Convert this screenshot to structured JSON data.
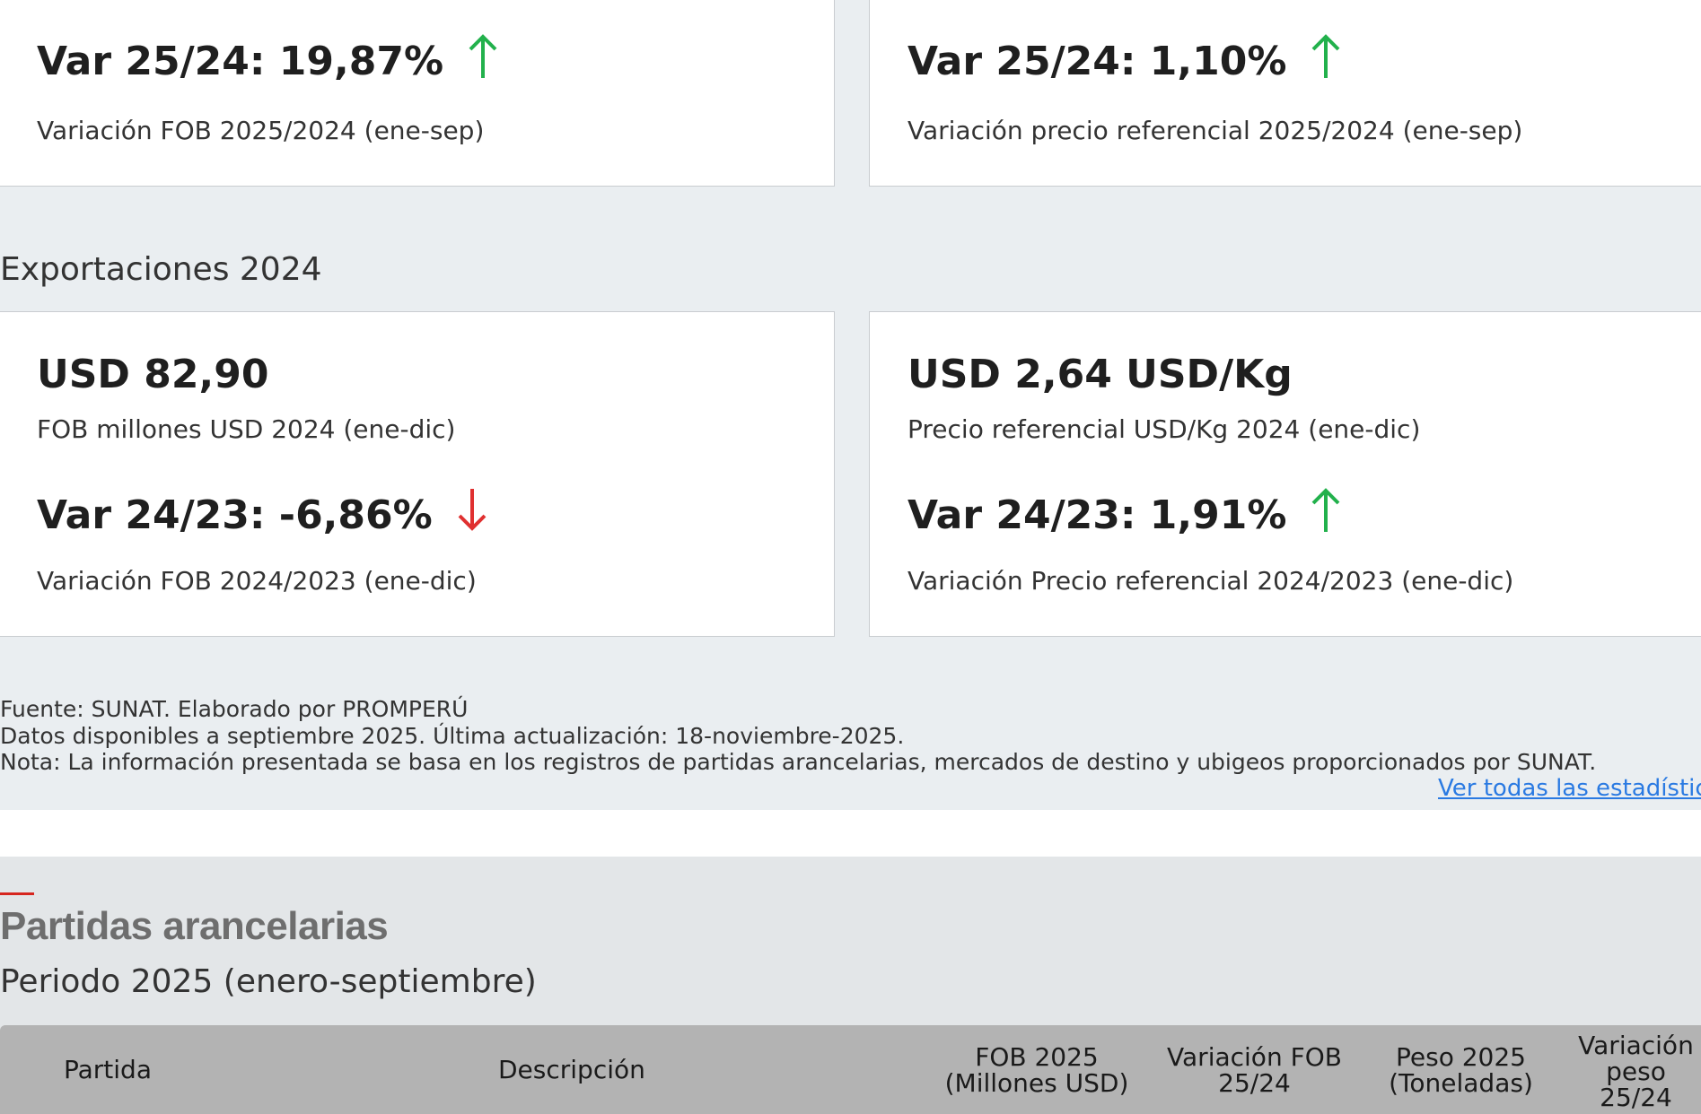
{
  "cards_2025": [
    {
      "var": "Var 25/24: 19,87%",
      "caption": "Variación FOB 2025/2024 (ene-sep)",
      "trend": "up"
    },
    {
      "var": "Var 25/24: 1,10%",
      "caption": "Variación precio referencial 2025/2024 (ene-sep)",
      "trend": "up"
    }
  ],
  "section_2024": {
    "title": "Exportaciones 2024",
    "cards": [
      {
        "value": "USD 82,90",
        "label": "FOB millones USD 2024 (ene-dic)",
        "var": "Var 24/23: -6,86%",
        "caption": "Variación FOB 2024/2023 (ene-dic)",
        "trend": "down"
      },
      {
        "value": "USD 2,64 USD/Kg",
        "label": "Precio referencial USD/Kg 2024 (ene-dic)",
        "var": "Var 24/23: 1,91%",
        "caption": "Variación Precio referencial 2024/2023 (ene-dic)",
        "trend": "up"
      }
    ]
  },
  "footnotes": [
    "Fuente: SUNAT. Elaborado por PROMPERÚ",
    "Datos disponibles a septiembre 2025. Última actualización: 18-noviembre-2025.",
    "Nota: La información presentada se basa en los registros de partidas arancelarias, mercados de destino y ubigeos proporcionados por SUNAT."
  ],
  "see_all_link": "Ver todas las estadísticas",
  "partidas": {
    "title": "Partidas arancelarias",
    "period": "Periodo 2025 (enero-septiembre)",
    "columns": [
      [
        "Partida"
      ],
      [
        "Descripción"
      ],
      [
        "FOB 2025",
        "(Millones USD)"
      ],
      [
        "Variación FOB",
        "25/24"
      ],
      [
        "Peso 2025",
        "(Toneladas)"
      ],
      [
        "Variación",
        "peso",
        "25/24"
      ]
    ]
  },
  "colors": {
    "up": "#22b14c",
    "down": "#e03030",
    "accent": "#d6261f",
    "link": "#2a7ae2"
  }
}
